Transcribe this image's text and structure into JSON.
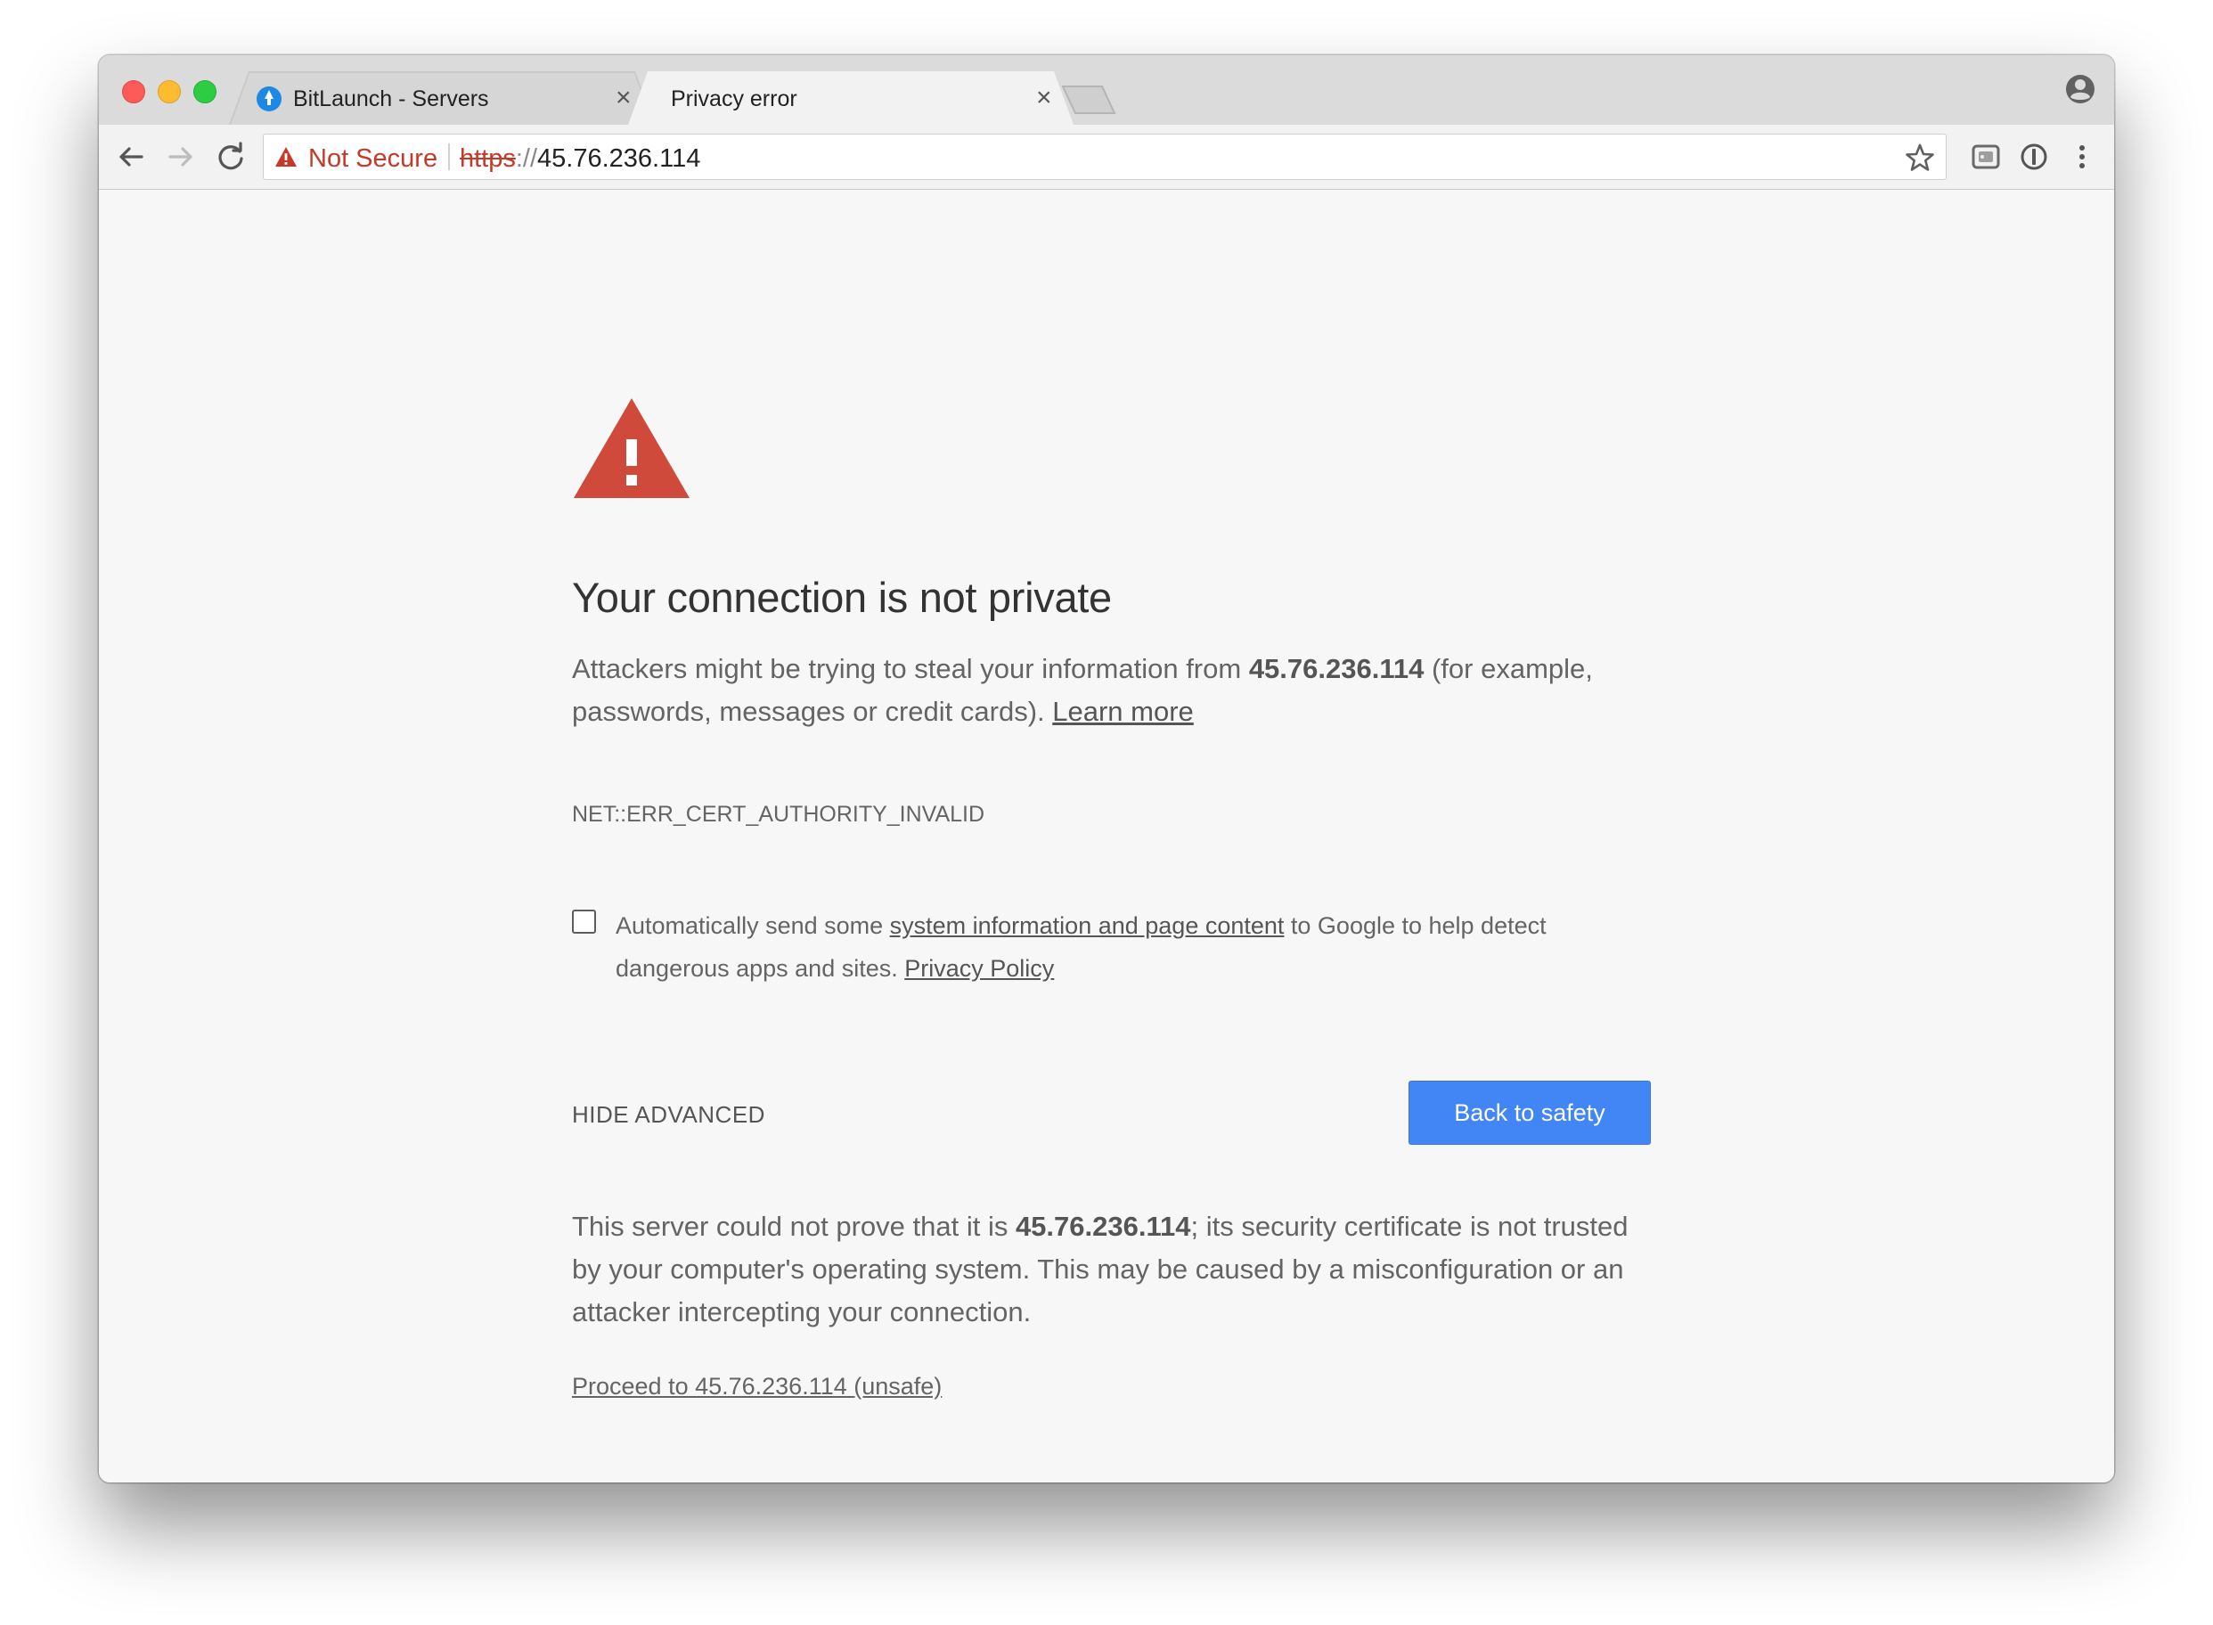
{
  "tabs": [
    {
      "title": "BitLaunch - Servers",
      "active": false
    },
    {
      "title": "Privacy error",
      "active": true
    }
  ],
  "tab_close_glyph": "×",
  "omnibox": {
    "security_label": "Not Secure",
    "url_scheme": "https",
    "url_separator": "://",
    "url_host": "45.76.236.114"
  },
  "interstitial": {
    "heading": "Your connection is not private",
    "intro_prefix": "Attackers might be trying to steal your information from ",
    "host": "45.76.236.114",
    "intro_suffix": " (for example, passwords, messages or credit cards). ",
    "learn_more": "Learn more",
    "error_code": "NET::ERR_CERT_AUTHORITY_INVALID",
    "report": {
      "prefix": "Automatically send some ",
      "link": "system information and page content",
      "middle": " to Google to help detect dangerous apps and sites. ",
      "privacy_link": "Privacy Policy",
      "checked": false
    },
    "hide_advanced": "HIDE ADVANCED",
    "back_button": "Back to safety",
    "details_prefix": "This server could not prove that it is ",
    "details_host": "45.76.236.114",
    "details_suffix": "; its security certificate is not trusted by your computer's operating system. This may be caused by a misconfiguration or an attacker intercepting your connection.",
    "proceed_link": "Proceed to 45.76.236.114 (unsafe)"
  },
  "colors": {
    "warning_red": "#c53929",
    "button_blue": "#4285f4",
    "page_background": "#f7f7f7"
  },
  "icons": {
    "toolbar": [
      "back-arrow-icon",
      "forward-arrow-icon",
      "reload-icon",
      "bookmark-star-icon",
      "extension-cast-icon",
      "password-manager-icon",
      "kebab-menu-icon",
      "profile-icon"
    ],
    "warning": "warning-triangle-icon"
  }
}
